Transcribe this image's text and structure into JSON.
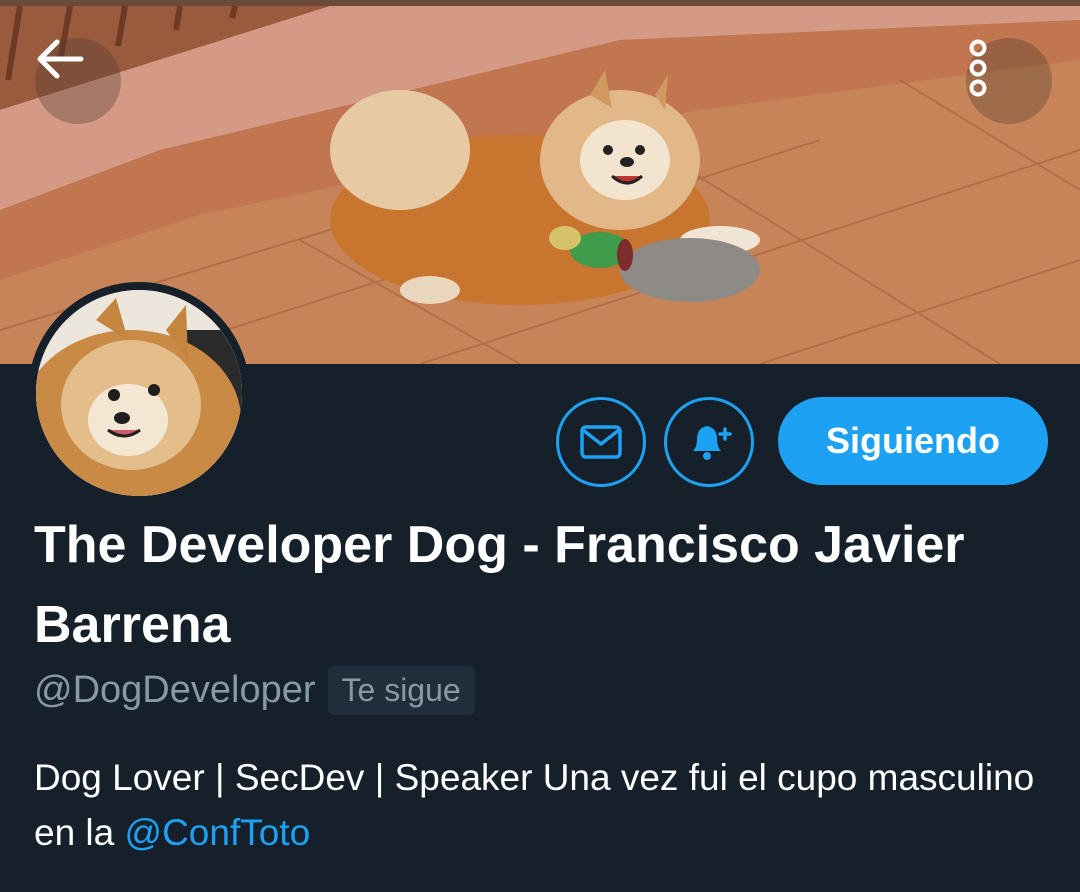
{
  "header": {
    "back_icon": "arrow-left-icon",
    "more_icon": "more-vertical-icon",
    "banner_image": "pomeranian-dog-with-duck-toy-photo"
  },
  "actions": {
    "message_icon": "mail-icon",
    "notify_icon": "bell-plus-icon",
    "follow_label": "Siguiendo"
  },
  "profile": {
    "display_name": "The Developer Dog - Francisco Javier Barrena",
    "handle": "@DogDeveloper",
    "follows_you": "Te sigue",
    "bio_text": "Dog Lover | SecDev | Speaker  Una vez fui el cupo masculino en la ",
    "bio_mention": "@ConfToto"
  },
  "colors": {
    "background": "#15202b",
    "accent": "#1da1f2",
    "secondary_text": "#8899a6"
  }
}
